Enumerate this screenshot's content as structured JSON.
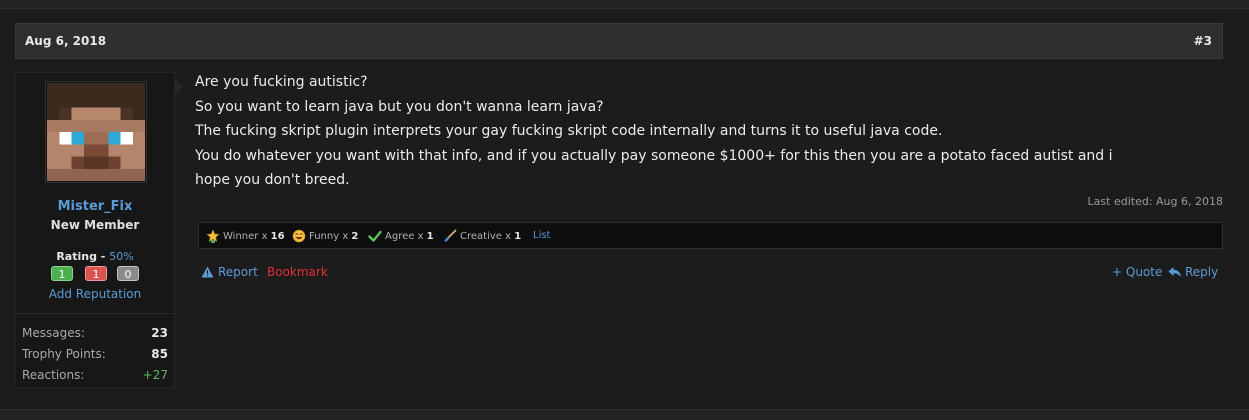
{
  "post": {
    "date": "Aug 6, 2018",
    "number": "#3",
    "message_lines": [
      "Are you fucking autistic?",
      "So you want to learn java but you don't wanna learn java?",
      "The fucking skript plugin interprets your gay fucking skript code internally and turns it to useful java code.",
      "You do whatever you want with that info, and if you actually pay someone $1000+ for this then you are a potato faced autist and i",
      "hope you don't breed."
    ],
    "last_edited": "Last edited: Aug 6, 2018"
  },
  "user": {
    "name": "Mister_Fix",
    "title": "New Member",
    "rating_label": "Rating -",
    "rating_percent": "50%",
    "rating_positive": "1",
    "rating_negative": "1",
    "rating_neutral": "0",
    "add_reputation": "Add Reputation",
    "stats": [
      {
        "label": "Messages:",
        "value": "23"
      },
      {
        "label": "Trophy Points:",
        "value": "85"
      },
      {
        "label": "Reactions:",
        "value": "+27"
      }
    ],
    "avatar_icon": "minecraft-steve-avatar"
  },
  "reactions": [
    {
      "icon": "winner-medal-icon",
      "label": "Winner x",
      "count": "16"
    },
    {
      "icon": "funny-face-icon",
      "label": "Funny x",
      "count": "2"
    },
    {
      "icon": "agree-check-icon",
      "label": "Agree x",
      "count": "1"
    },
    {
      "icon": "creative-brush-icon",
      "label": "Creative x",
      "count": "1"
    }
  ],
  "reactions_list_link": "List",
  "actions": {
    "report": "Report",
    "bookmark": "Bookmark",
    "quote": "+ Quote",
    "reply": "Reply"
  },
  "colors": {
    "link": "#5b9bd5",
    "bookmark": "#e0303a",
    "positive": "#4caf50",
    "negative": "#d9534f",
    "neutral": "#8a8a8a"
  }
}
